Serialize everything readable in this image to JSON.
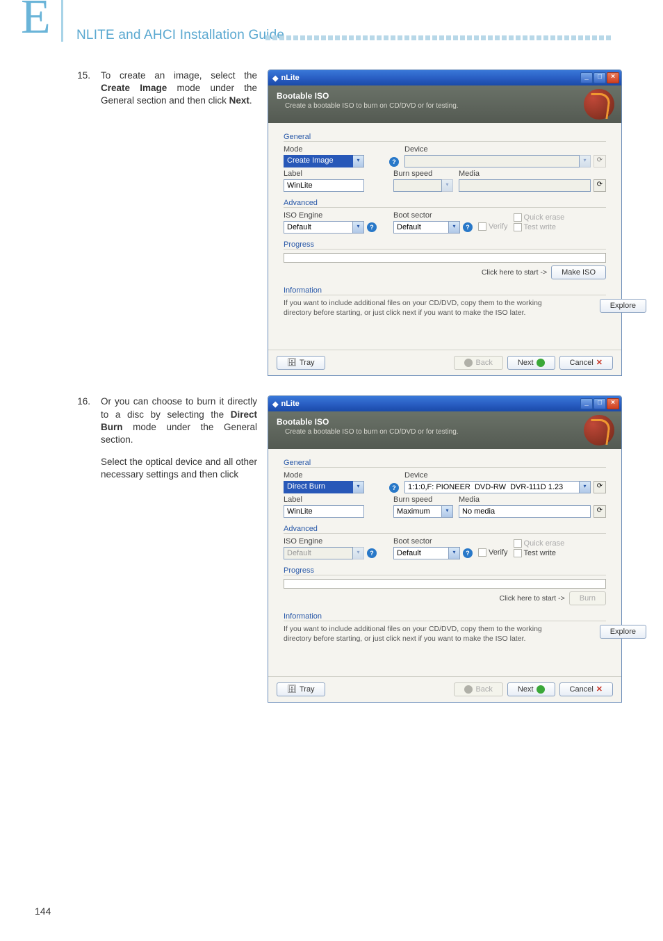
{
  "header": {
    "letter": "E",
    "title": "NLITE and AHCI Installation Guide"
  },
  "step15": {
    "num": "15.",
    "text_before": "To create an image, select the ",
    "bold1": "Create Image",
    "text_mid": " mode under the General section and then click ",
    "bold2": "Next",
    "text_after": "."
  },
  "step16": {
    "num": "16.",
    "p1_before": "Or you can choose to burn it directly to a disc by selecting the ",
    "p1_bold": "Direct Burn",
    "p1_after": " mode under the General section.",
    "p2": "Select the optical device and all other necessary settings and then click"
  },
  "win1": {
    "title": "nLite",
    "header_title": "Bootable ISO",
    "header_sub": "Create a bootable ISO to burn on CD/DVD or for testing.",
    "fs_general": "General",
    "mode_lbl": "Mode",
    "mode_val": "Create Image",
    "device_lbl": "Device",
    "device_val": "",
    "label_lbl": "Label",
    "label_val": "WinLite",
    "burnspeed_lbl": "Burn speed",
    "burnspeed_val": "",
    "media_lbl": "Media",
    "media_val": "",
    "fs_advanced": "Advanced",
    "iso_lbl": "ISO Engine",
    "iso_val": "Default",
    "boot_lbl": "Boot sector",
    "boot_val": "Default",
    "verify": "Verify",
    "quick": "Quick erase",
    "test": "Test write",
    "fs_progress": "Progress",
    "click_start": "Click here to start ->",
    "make_iso": "Make ISO",
    "fs_info": "Information",
    "info_text": "If you want to include additional files on your CD/DVD, copy them to the working directory before starting, or just click next if you want to make the ISO later.",
    "explore": "Explore",
    "tray": "Tray",
    "back": "Back",
    "next": "Next",
    "cancel": "Cancel"
  },
  "win2": {
    "title": "nLite",
    "header_title": "Bootable ISO",
    "header_sub": "Create a bootable ISO to burn on CD/DVD or for testing.",
    "fs_general": "General",
    "mode_lbl": "Mode",
    "mode_val": "Direct Burn",
    "device_lbl": "Device",
    "device_val": "1:1:0,F: PIONEER  DVD-RW  DVR-111D 1.23",
    "label_lbl": "Label",
    "label_val": "WinLite",
    "burnspeed_lbl": "Burn speed",
    "burnspeed_val": "Maximum",
    "media_lbl": "Media",
    "media_val": "No media",
    "fs_advanced": "Advanced",
    "iso_lbl": "ISO Engine",
    "iso_val": "Default",
    "boot_lbl": "Boot sector",
    "boot_val": "Default",
    "verify": "Verify",
    "quick": "Quick erase",
    "test": "Test write",
    "fs_progress": "Progress",
    "click_start": "Click here to start ->",
    "burn": "Burn",
    "fs_info": "Information",
    "info_text": "If you want to include additional files on your CD/DVD, copy them to the working directory before starting, or just click next if you want to make the ISO later.",
    "explore": "Explore",
    "tray": "Tray",
    "back": "Back",
    "next": "Next",
    "cancel": "Cancel"
  },
  "page_num": "144"
}
